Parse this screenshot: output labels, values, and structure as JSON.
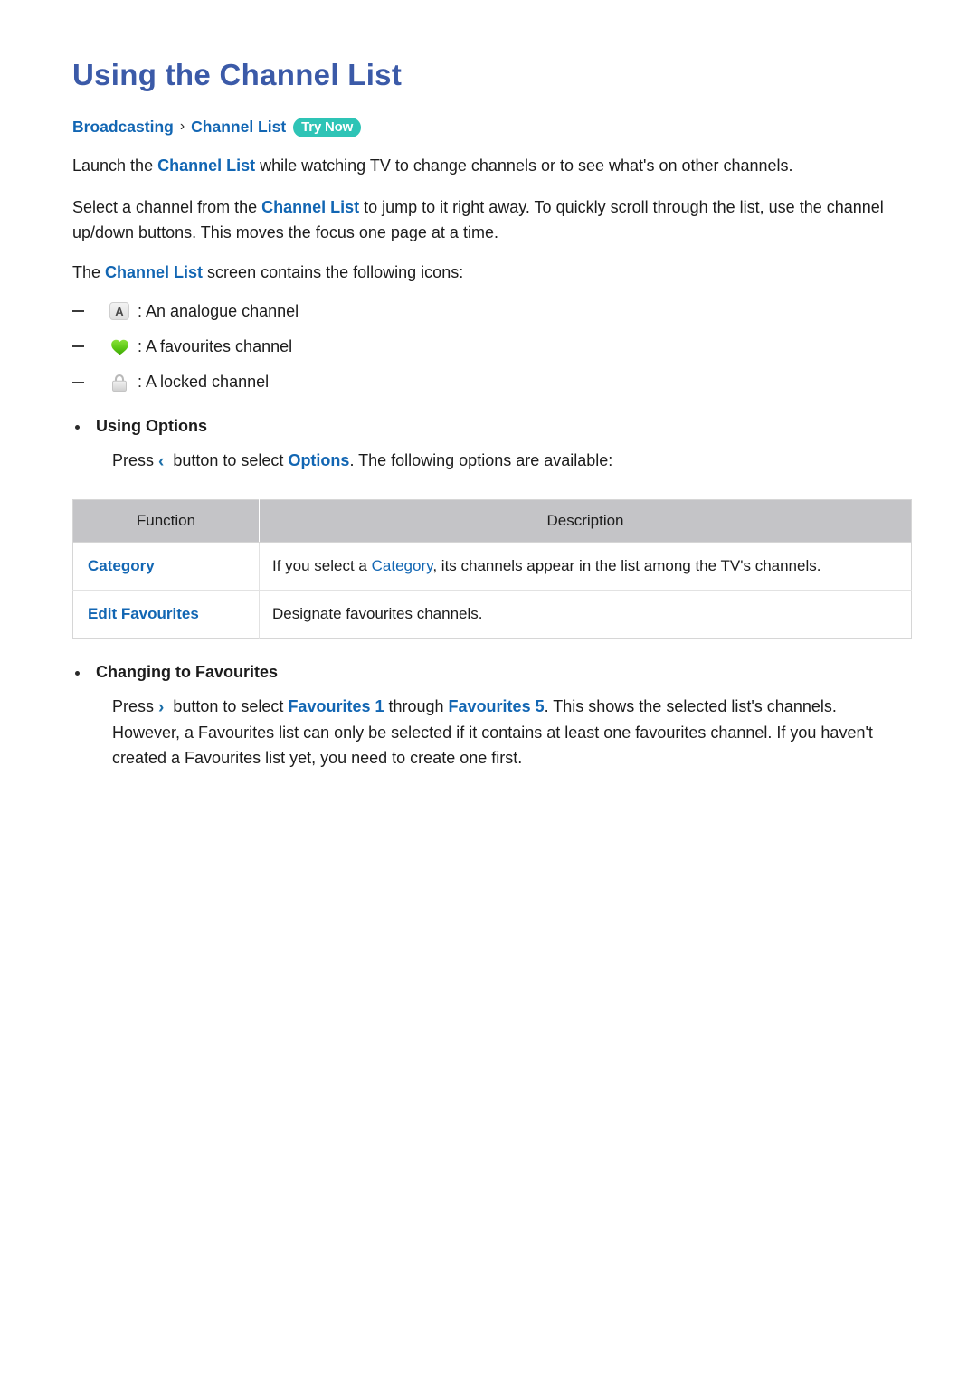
{
  "page": {
    "title": "Using the Channel List"
  },
  "breadcrumb": {
    "root": "Broadcasting",
    "separator": "›",
    "leaf": "Channel List",
    "badge": "Try Now",
    "badge_color": "#2ec4b6"
  },
  "intro": {
    "p1_a": "Launch the ",
    "p1_kw": "Channel List",
    "p1_b": " while watching TV to change channels or to see what's on other channels.",
    "p2_a": "Select a channel from the ",
    "p2_kw": "Channel List",
    "p2_b": " to jump to it right away. To quickly scroll through the list, use the channel up/down buttons. This moves the focus one page at a time.",
    "p3_a": "The ",
    "p3_kw": "Channel List",
    "p3_b": " screen contains the following icons:"
  },
  "icon_legend": [
    {
      "icon": "analogue-channel-icon",
      "glyph": "A",
      "text": ": An analogue channel"
    },
    {
      "icon": "favourites-heart-icon",
      "glyph": "",
      "text": ": A favourites channel"
    },
    {
      "icon": "locked-channel-icon",
      "glyph": "",
      "text": ": A locked channel"
    }
  ],
  "using_options": {
    "heading": "Using Options",
    "press_label": "Press",
    "chevron": "‹",
    "body_a": " button to select ",
    "body_kw": "Options",
    "body_b": ". The following options are available:"
  },
  "options_table": {
    "headers": [
      "Function",
      "Description"
    ],
    "rows": [
      {
        "function": "Category",
        "desc_a": "If you select a ",
        "desc_kw": "Category",
        "desc_b": ", its channels appear in the list among the TV's channels."
      },
      {
        "function": "Edit Favourites",
        "desc_a": "Designate favourites channels.",
        "desc_kw": "",
        "desc_b": ""
      }
    ]
  },
  "changing_favourites": {
    "heading": "Changing to Favourites",
    "press_label": "Press",
    "chevron": "›",
    "body_a": " button to select ",
    "body_kw1": "Favourites 1",
    "body_mid": " through ",
    "body_kw2": "Favourites 5",
    "body_b": ". This shows the selected list's channels. However, a Favourites list can only be selected if it contains at least one favourites channel. If you haven't created a Favourites list yet, you need to create one first."
  },
  "colors": {
    "title_blue": "#3b5aa8",
    "link_blue": "#1266b3",
    "chevron_blue": "#1b6ea8",
    "table_header_gray": "#c4c4c7",
    "heart_green": "#5cc814"
  }
}
